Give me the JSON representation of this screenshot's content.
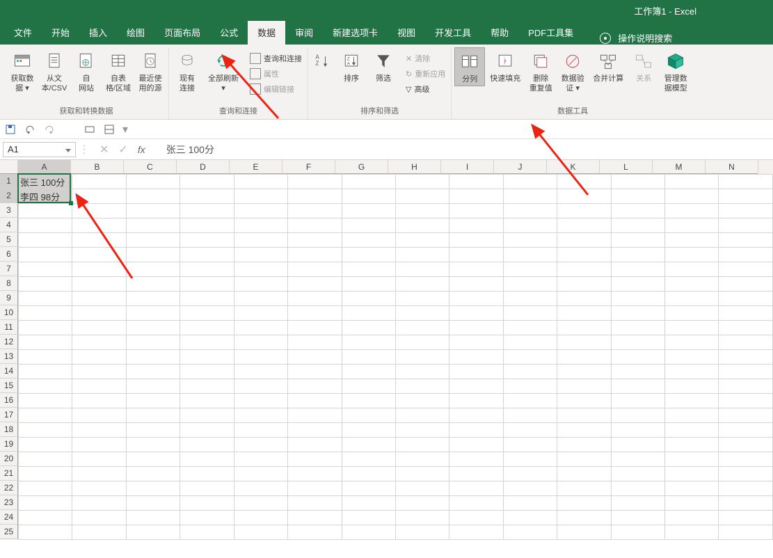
{
  "titlebar": {
    "title": "工作簿1  -  Excel"
  },
  "tabs": {
    "file": "文件",
    "home": "开始",
    "insert": "插入",
    "draw": "绘图",
    "layout": "页面布局",
    "formula": "公式",
    "data": "数据",
    "review": "审阅",
    "newtab": "新建选项卡",
    "view": "视图",
    "dev": "开发工具",
    "help": "帮助",
    "pdf": "PDF工具集"
  },
  "search_hint": "操作说明搜索",
  "ribbon": {
    "group1": {
      "label": "获取和转换数据",
      "btn_getdata": "获取数\n据 ▾",
      "btn_csv": "从文\n本/CSV",
      "btn_web": "自\n网站",
      "btn_table": "自表\n格/区域",
      "btn_recent": "最近使\n用的源"
    },
    "group2": {
      "label": "查询和连接",
      "btn_existing": "现有\n连接",
      "btn_refresh": "全部刷新\n▾",
      "small_query": "查询和连接",
      "small_props": "属性",
      "small_editlinks": "编辑链接"
    },
    "group3": {
      "label": "排序和筛选",
      "btn_sort": "排序",
      "btn_filter": "筛选",
      "small_clear": "清除",
      "small_reapply": "重新应用",
      "small_advanced": "高级"
    },
    "group4": {
      "label": "数据工具",
      "btn_texttocolumns": "分列",
      "btn_flashfill": "快速填充",
      "btn_removedup": "删除\n重复值",
      "btn_validate": "数据验\n证 ▾",
      "btn_consolidate": "合并计算",
      "btn_relation": "关系",
      "btn_model": "管理数\n据模型"
    }
  },
  "namebox": "A1",
  "formula_value": "张三   100分",
  "columns": [
    "A",
    "B",
    "C",
    "D",
    "E",
    "F",
    "G",
    "H",
    "I",
    "J",
    "K",
    "L",
    "M",
    "N"
  ],
  "rows_count": 25,
  "cells": {
    "A1": "张三  100分",
    "A2": "李四  98分"
  },
  "selected_column": "A",
  "selected_rows": [
    1,
    2
  ]
}
